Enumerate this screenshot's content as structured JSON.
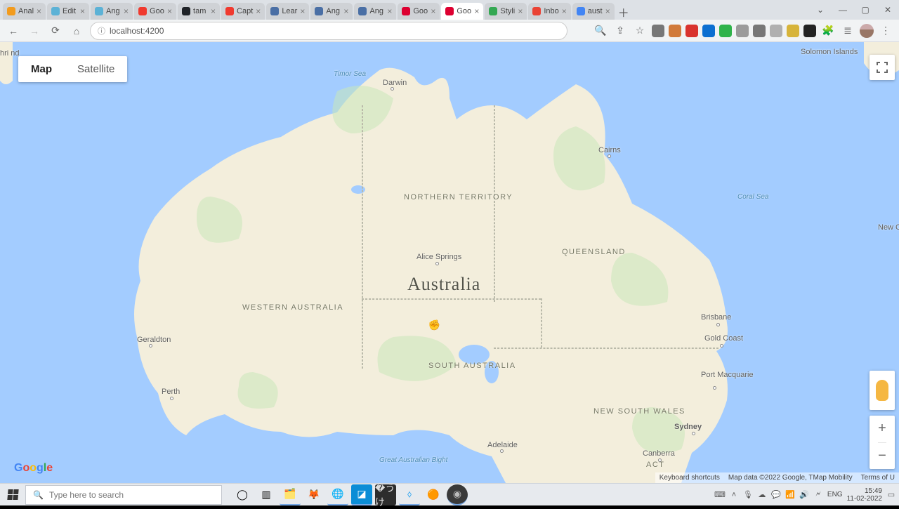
{
  "browser": {
    "tabs": [
      {
        "label": "Anal",
        "color": "#f29b1d",
        "active": false
      },
      {
        "label": "Edit",
        "color": "#5cb2d6",
        "active": false
      },
      {
        "label": "Ang",
        "color": "#5cb2d6",
        "active": false
      },
      {
        "label": "Goo",
        "color": "#f03a2f",
        "active": false
      },
      {
        "label": "tam",
        "color": "#1f2328",
        "active": false
      },
      {
        "label": "Capt",
        "color": "#f03a2f",
        "active": false
      },
      {
        "label": "Lear",
        "color": "#4a6fa5",
        "active": false
      },
      {
        "label": "Ang",
        "color": "#4a6fa5",
        "active": false
      },
      {
        "label": "Ang",
        "color": "#4a6fa5",
        "active": false
      },
      {
        "label": "Goo",
        "color": "#dd0031",
        "active": false
      },
      {
        "label": "Goo",
        "color": "#dd0031",
        "active": true
      },
      {
        "label": "Styli",
        "color": "#34a853",
        "active": false
      },
      {
        "label": "Inbo",
        "color": "#ea4335",
        "active": false
      },
      {
        "label": "aust",
        "color": "#4285f4",
        "active": false
      }
    ],
    "url": "localhost:4200",
    "extension_colors": [
      "#777",
      "#d17a3a",
      "#d9332e",
      "#0c6fd1",
      "#2fb34a",
      "#9b9b9b",
      "#777",
      "#b0b0b0",
      "#d7b43a",
      "#232323",
      "#6b6b6b",
      "#6b6b6b"
    ]
  },
  "map_ui": {
    "type_map": "Map",
    "type_sat": "Satellite"
  },
  "map_labels": {
    "country": "Australia",
    "states": {
      "nt": "NORTHERN TERRITORY",
      "wa": "WESTERN AUSTRALIA",
      "sa": "SOUTH AUSTRALIA",
      "qld": "QUEENSLAND",
      "nsw": "NEW SOUTH WALES",
      "act": "ACT"
    },
    "cities": {
      "darwin": "Darwin",
      "cairns": "Cairns",
      "alice": "Alice Springs",
      "brisbane": "Brisbane",
      "gold": "Gold Coast",
      "port_mac": "Port Macquarie",
      "sydney": "Sydney",
      "canberra": "Canberra",
      "adelaide": "Adelaide",
      "perth": "Perth",
      "geraldton": "Geraldton"
    },
    "water": {
      "timor": "Timor Sea",
      "coral": "Coral Sea",
      "bight": "Great Australian Bight"
    },
    "islands": {
      "solomon": "Solomon Islands",
      "newcal": "New Cale…",
      "chri": "hri nd"
    }
  },
  "attribution": {
    "shortcuts": "Keyboard shortcuts",
    "data": "Map data ©2022 Google, TMap Mobility",
    "terms": "Terms of U"
  },
  "taskbar": {
    "search_placeholder": "Type here to search",
    "lang": "ENG",
    "clock_time": "15:49",
    "clock_date": "11-02-2022"
  }
}
